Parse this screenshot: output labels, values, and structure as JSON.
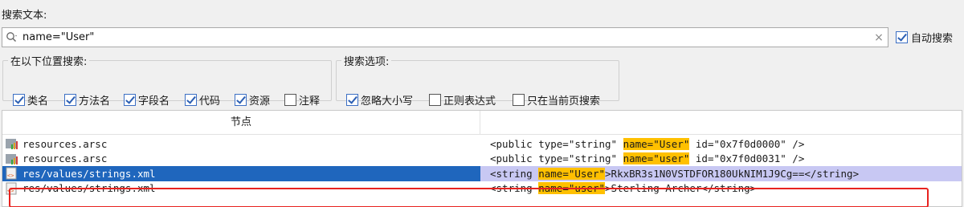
{
  "search": {
    "label": "搜索文本:",
    "value": "name=\"User\"",
    "clear_icon": "×",
    "auto_search_label": "自动搜索"
  },
  "location_group": {
    "title": "在以下位置搜索:",
    "options": [
      {
        "label": "类名",
        "checked": true
      },
      {
        "label": "方法名",
        "checked": true
      },
      {
        "label": "字段名",
        "checked": true
      },
      {
        "label": "代码",
        "checked": true
      },
      {
        "label": "资源",
        "checked": true
      },
      {
        "label": "注释",
        "checked": false
      }
    ]
  },
  "options_group": {
    "title": "搜索选项:",
    "options": [
      {
        "label": "忽略大小写",
        "checked": true
      },
      {
        "label": "正则表达式",
        "checked": false
      },
      {
        "label": "只在当前页搜索",
        "checked": false
      }
    ]
  },
  "table": {
    "header_node": "节点",
    "rows": [
      {
        "file": "resources.arsc",
        "icon": "arsc-file-icon",
        "pre": "<public type=\"string\" ",
        "match": "name=\"User\"",
        "post": " id=\"0x7f0d0000\" />"
      },
      {
        "file": "resources.arsc",
        "icon": "arsc-file-icon",
        "pre": "<public type=\"string\" ",
        "match": "name=\"user\"",
        "post": " id=\"0x7f0d0031\" />"
      },
      {
        "file": "res/values/strings.xml",
        "icon": "xml-file-icon",
        "pre": "<string ",
        "match": "name=\"User\"",
        "post": ">RkxBR3s1N0VSTDFOR180UkNIM1J9Cg==</string>"
      },
      {
        "file": "res/values/strings.xml",
        "icon": "xml-file-icon",
        "pre": "<string ",
        "match": "name=\"user\"",
        "post": ">Sterling Archer</string>"
      }
    ]
  },
  "colors": {
    "selection": "#1f66bd",
    "highlight": "#ffc000",
    "outline": "#e8221f"
  }
}
